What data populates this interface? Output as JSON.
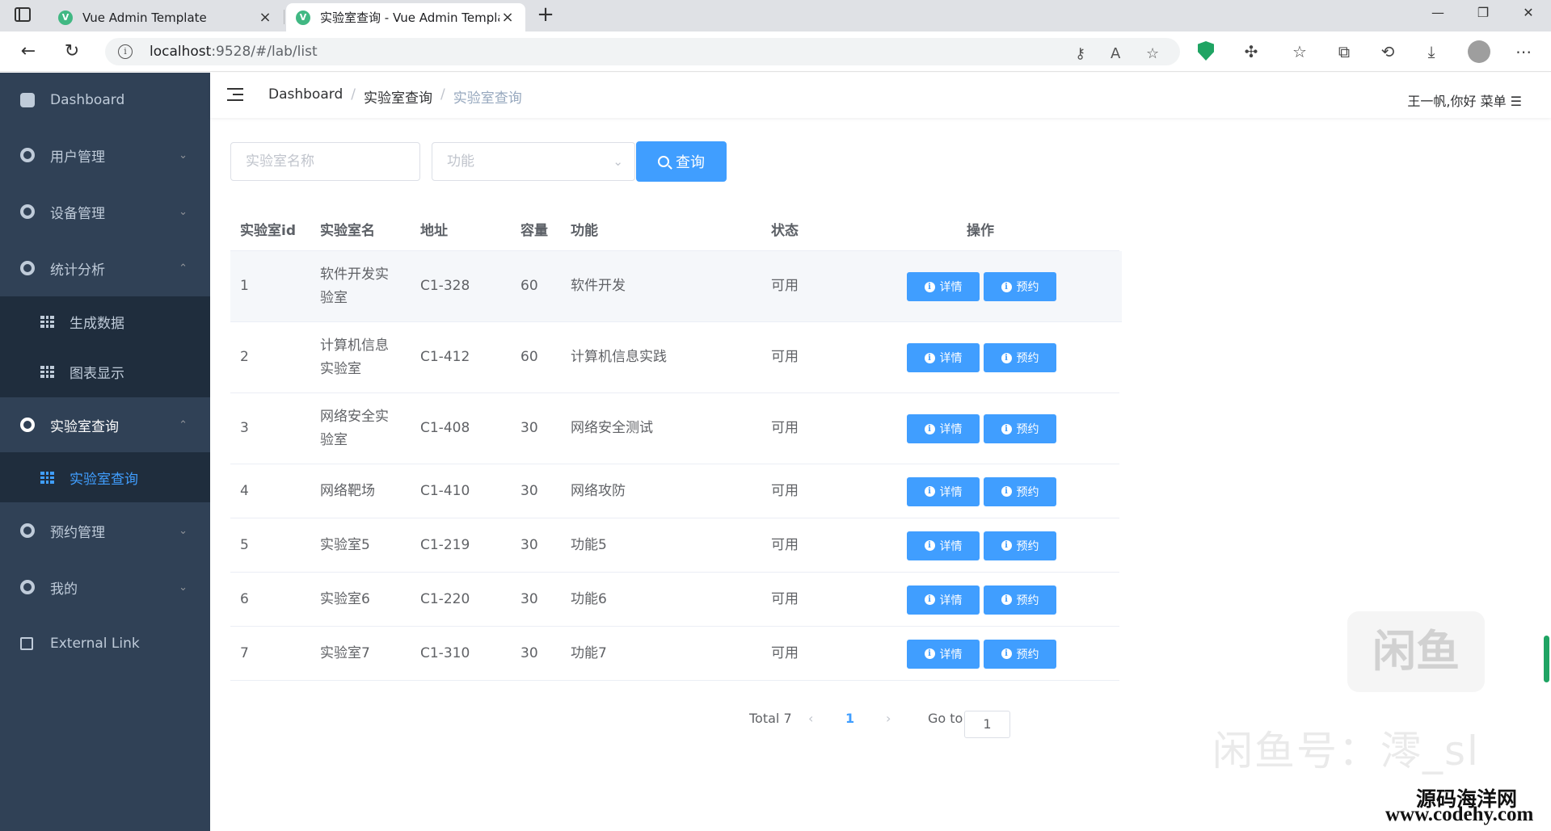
{
  "browser": {
    "tabs": [
      {
        "title": "Vue Admin Template",
        "active": false
      },
      {
        "title": "实验室查询 - Vue Admin Templa",
        "active": true
      }
    ],
    "url_host": "localhost",
    "url_rest": ":9528/#/lab/list"
  },
  "sidebar": {
    "items": [
      {
        "label": "Dashboard",
        "icon": "dashboard-icon"
      },
      {
        "label": "用户管理",
        "icon": "gear-icon",
        "expandable": true
      },
      {
        "label": "设备管理",
        "icon": "gear-icon",
        "expandable": true
      },
      {
        "label": "统计分析",
        "icon": "gear-icon",
        "expanded": true
      },
      {
        "label": "实验室查询",
        "icon": "gear-icon",
        "expanded": true
      },
      {
        "label": "预约管理",
        "icon": "gear-icon",
        "expandable": true
      },
      {
        "label": "我的",
        "icon": "gear-icon",
        "expandable": true
      },
      {
        "label": "External Link",
        "icon": "external-link-icon"
      }
    ],
    "stats_sub": [
      {
        "label": "生成数据",
        "icon": "table-icon"
      },
      {
        "label": "图表显示",
        "icon": "table-icon"
      }
    ],
    "lab_sub": [
      {
        "label": "实验室查询",
        "icon": "table-icon",
        "active": true
      }
    ]
  },
  "navbar": {
    "breadcrumb": [
      "Dashboard",
      "实验室查询",
      "实验室查询"
    ],
    "user": "王一帆,你好 菜单 ☰"
  },
  "filters": {
    "name_placeholder": "实验室名称",
    "function_placeholder": "功能",
    "query_label": "查询"
  },
  "table": {
    "headers": [
      "实验室id",
      "实验室名",
      "地址",
      "容量",
      "功能",
      "状态",
      "操作"
    ],
    "rows": [
      {
        "id": "1",
        "name_l1": "软件开发实",
        "name_l2": "验室",
        "addr": "C1-328",
        "cap": "60",
        "func": "软件开发",
        "status": "可用"
      },
      {
        "id": "2",
        "name_l1": "计算机信息",
        "name_l2": "实验室",
        "addr": "C1-412",
        "cap": "60",
        "func": "计算机信息实践",
        "status": "可用"
      },
      {
        "id": "3",
        "name_l1": "网络安全实",
        "name_l2": "验室",
        "addr": "C1-408",
        "cap": "30",
        "func": "网络安全测试",
        "status": "可用"
      },
      {
        "id": "4",
        "name_l1": "网络靶场",
        "name_l2": "",
        "addr": "C1-410",
        "cap": "30",
        "func": "网络攻防",
        "status": "可用"
      },
      {
        "id": "5",
        "name_l1": "实验室5",
        "name_l2": "",
        "addr": "C1-219",
        "cap": "30",
        "func": "功能5",
        "status": "可用"
      },
      {
        "id": "6",
        "name_l1": "实验室6",
        "name_l2": "",
        "addr": "C1-220",
        "cap": "30",
        "func": "功能6",
        "status": "可用"
      },
      {
        "id": "7",
        "name_l1": "实验室7",
        "name_l2": "",
        "addr": "C1-310",
        "cap": "30",
        "func": "功能7",
        "status": "可用"
      }
    ],
    "detail_label": "详情",
    "reserve_label": "预约"
  },
  "pagination": {
    "total": "Total 7",
    "page": "1",
    "goto_label": "Go to",
    "goto_value": "1"
  },
  "watermark": {
    "logo": "闲鱼",
    "id_text": "闲鱼号：澪_sl",
    "site_cn": "源码海洋网",
    "site_url": "www.codehy.com"
  },
  "colors": {
    "primary": "#409eff",
    "sidebar": "#304156",
    "submenu": "#1f2d3d"
  }
}
